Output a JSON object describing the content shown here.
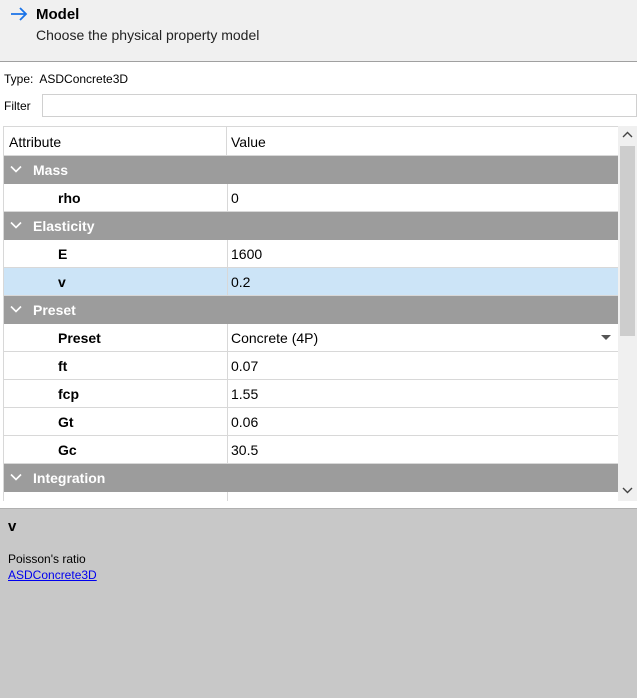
{
  "header": {
    "title": "Model",
    "subtitle": "Choose the physical property model"
  },
  "type_row": {
    "label": "Type:",
    "value": "ASDConcrete3D"
  },
  "filter": {
    "label": "Filter",
    "value": "",
    "placeholder": ""
  },
  "grid": {
    "col_attribute": "Attribute",
    "col_value": "Value",
    "groups": {
      "mass": {
        "label": "Mass",
        "rho": {
          "name": "rho",
          "value": "0"
        }
      },
      "elasticity": {
        "label": "Elasticity",
        "E": {
          "name": "E",
          "value": "1600"
        },
        "v": {
          "name": "v",
          "value": "0.2"
        }
      },
      "preset": {
        "label": "Preset",
        "preset": {
          "name": "Preset",
          "value": "Concrete (4P)"
        },
        "ft": {
          "name": "ft",
          "value": "0.07"
        },
        "fcp": {
          "name": "fcp",
          "value": "1.55"
        },
        "Gt": {
          "name": "Gt",
          "value": "0.06"
        },
        "Gc": {
          "name": "Gc",
          "value": "30.5"
        }
      },
      "integration": {
        "label": "Integration"
      }
    }
  },
  "info": {
    "name": "v",
    "description": "Poisson's ratio",
    "link": "ASDConcrete3D"
  },
  "icons": {
    "header": "arrow-right-icon",
    "group": "chevron-down-icon",
    "dropdown": "dropdown-arrow-icon",
    "scroll_up": "scroll-up-icon",
    "scroll_down": "scroll-down-icon"
  },
  "colors": {
    "accent": "#1a73e8",
    "group_header": "#9c9c9c",
    "selection": "#cce4f7",
    "info_panel": "#c8c8c8"
  }
}
